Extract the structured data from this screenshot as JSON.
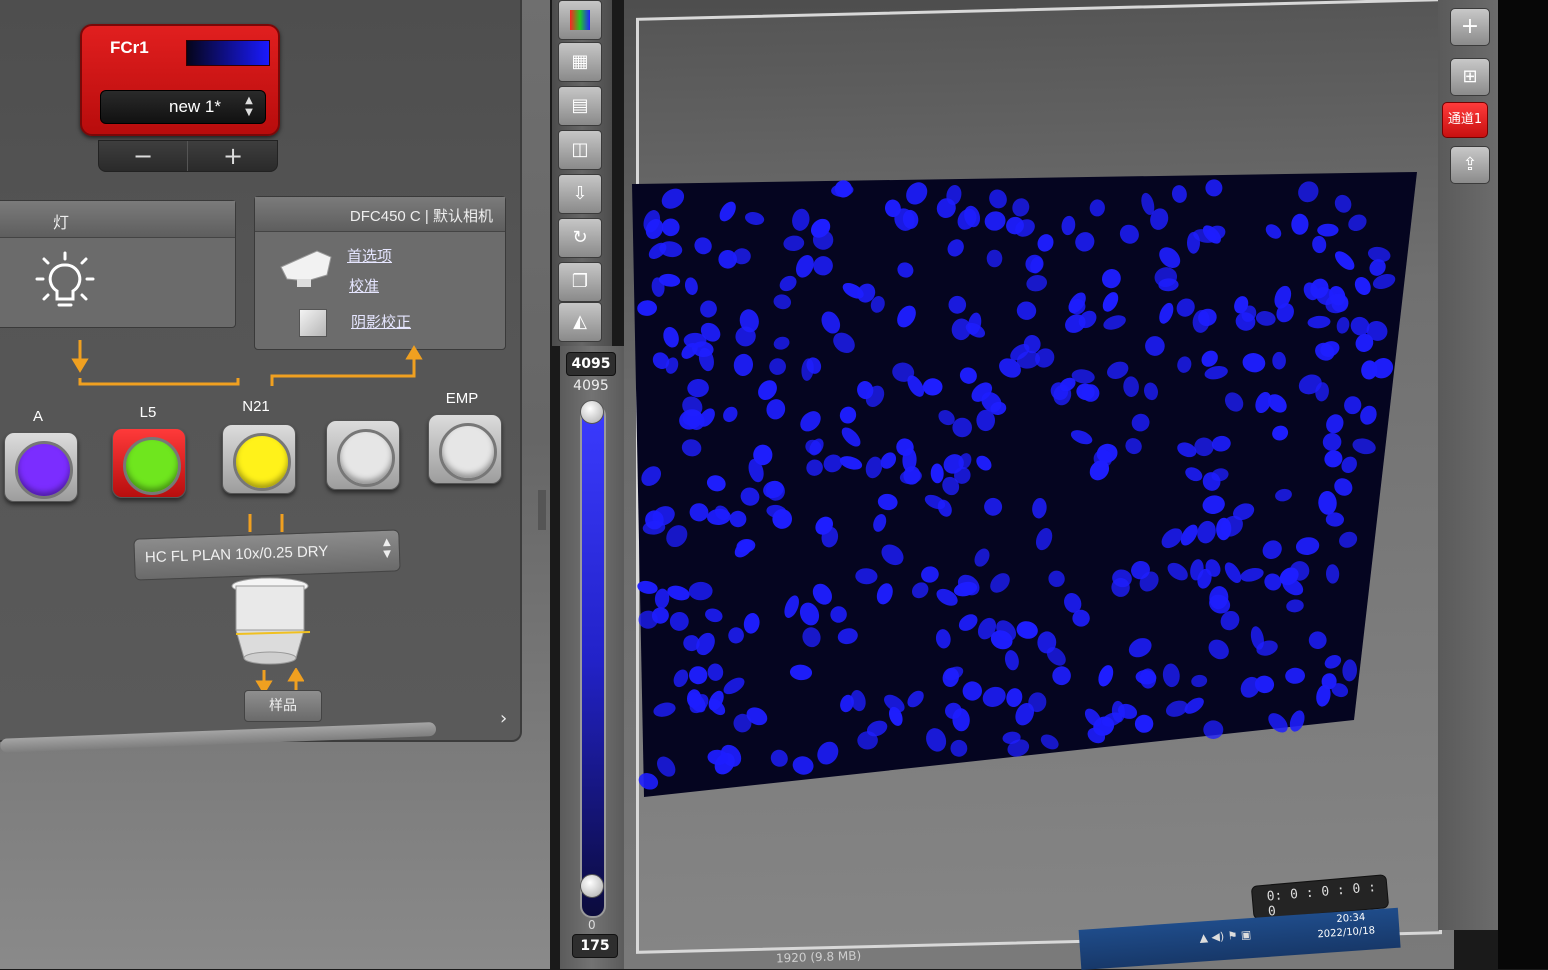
{
  "fluorescence_cube": {
    "title": "FCr1",
    "config_value": "new 1*",
    "minus_label": "−",
    "plus_label": "+"
  },
  "lamp": {
    "title": "灯",
    "icon": "lightbulb-icon"
  },
  "camera": {
    "title": "DFC450 C | 默认相机",
    "preferences_label": "首选项",
    "calibration_label": "校准",
    "shading_label": "阴影校正",
    "shading_checked": false
  },
  "filters": [
    {
      "label": "A",
      "color": "#7b2dff",
      "selected": false
    },
    {
      "label": "L5",
      "color": "#6fe61e",
      "selected": true
    },
    {
      "label": "N21",
      "color": "#fff21a",
      "selected": false
    },
    {
      "label": "",
      "color": "#e6e6e6",
      "selected": false
    },
    {
      "label": "EMP",
      "color": "#e6e6e6",
      "selected": false
    }
  ],
  "objective": {
    "label": "HC FL PLAN    10x/0.25 DRY",
    "sample_label": "样品"
  },
  "lut": {
    "max_box": "4095",
    "max_label": "4095",
    "min_label": "0",
    "min_box": "175",
    "color": "#2020ff"
  },
  "toolbar": {
    "icons": [
      "color-lut-icon",
      "measure-icon",
      "stack-icon",
      "overlay-icon",
      "z-icon",
      "refresh-icon",
      "copy-icon",
      "histogram-icon"
    ]
  },
  "right_tools": {
    "add_label": "+",
    "layout_icon": "grid-layout-icon",
    "channel_label": "通道1",
    "export_icon": "export-icon"
  },
  "viewer": {
    "background_color": "#050520",
    "nuclei_color": "#1e1eff"
  },
  "status": {
    "timer": "0: 0 : 0 : 0 : 0",
    "file_info": "1920   (9.8 MB)",
    "time": "20:34",
    "date": "2022/10/18"
  }
}
